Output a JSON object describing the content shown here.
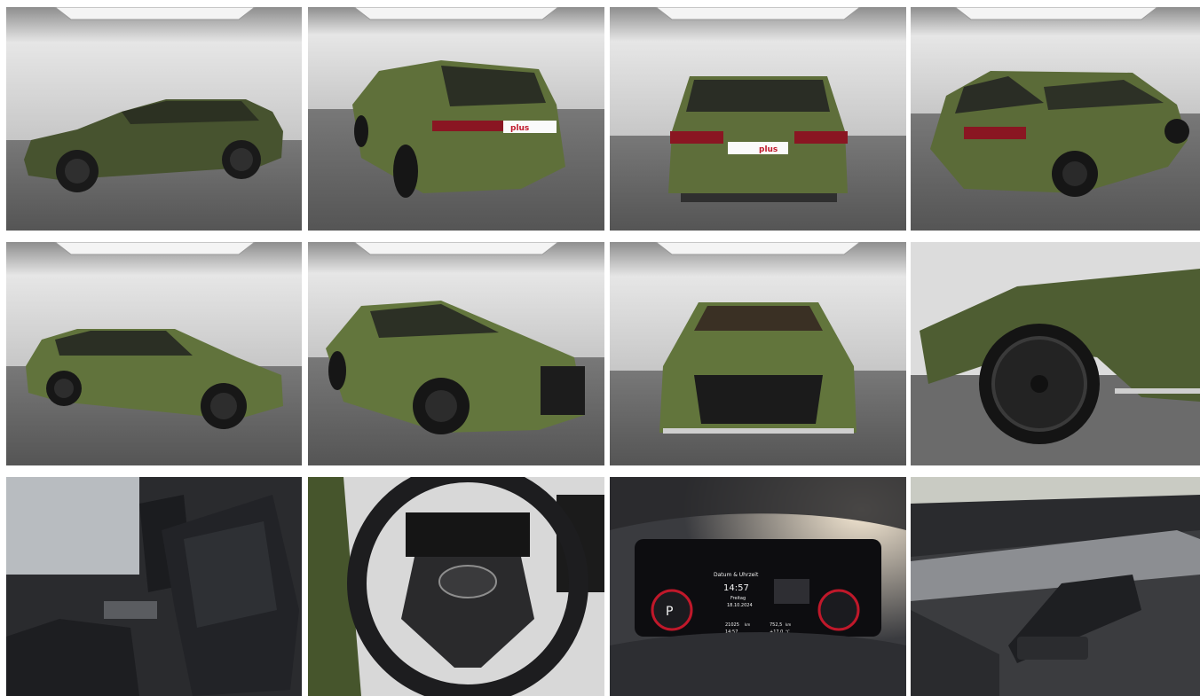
{
  "gallery": {
    "colors": {
      "car_green": "#5b6b3a",
      "car_green_dark": "#3f4a28",
      "studio_wall": "#d9d9d9",
      "studio_floor": "#5e5e5e",
      "interior_dark": "#1e1f22"
    },
    "photos": [
      {
        "name": "photo-side-left",
        "view": "side-left-studio"
      },
      {
        "name": "photo-rear-three-quarter-left",
        "view": "rear-three-quarter-left-studio"
      },
      {
        "name": "photo-rear",
        "view": "rear-studio",
        "plate_text": "plus"
      },
      {
        "name": "photo-rear-three-quarter-right",
        "view": "rear-three-quarter-right-studio"
      },
      {
        "name": "photo-front-three-quarter-right",
        "view": "front-three-quarter-right-studio"
      },
      {
        "name": "photo-front-three-quarter-left",
        "view": "front-three-quarter-left-studio"
      },
      {
        "name": "photo-front",
        "view": "front-studio"
      },
      {
        "name": "photo-wheel-closeup",
        "view": "front-wheel-closeup"
      },
      {
        "name": "photo-front-seats",
        "view": "interior-seats"
      },
      {
        "name": "photo-steering-wheel",
        "view": "interior-steering-wheel"
      },
      {
        "name": "photo-instrument-cluster",
        "view": "virtual-cockpit",
        "cluster": {
          "menu_title": "Datum & Uhrzeit",
          "time": "14:57",
          "day": "Freitag",
          "date": "18.10.2024",
          "odometer": "21025",
          "odometer_unit": "km",
          "trip_time": "14:57",
          "trip_km": "752,5",
          "trip_unit": "km",
          "temperature": "+17,0",
          "temp_unit": "°C",
          "gear": "P"
        }
      },
      {
        "name": "photo-door-panel",
        "view": "interior-door-window-switches"
      }
    ]
  }
}
